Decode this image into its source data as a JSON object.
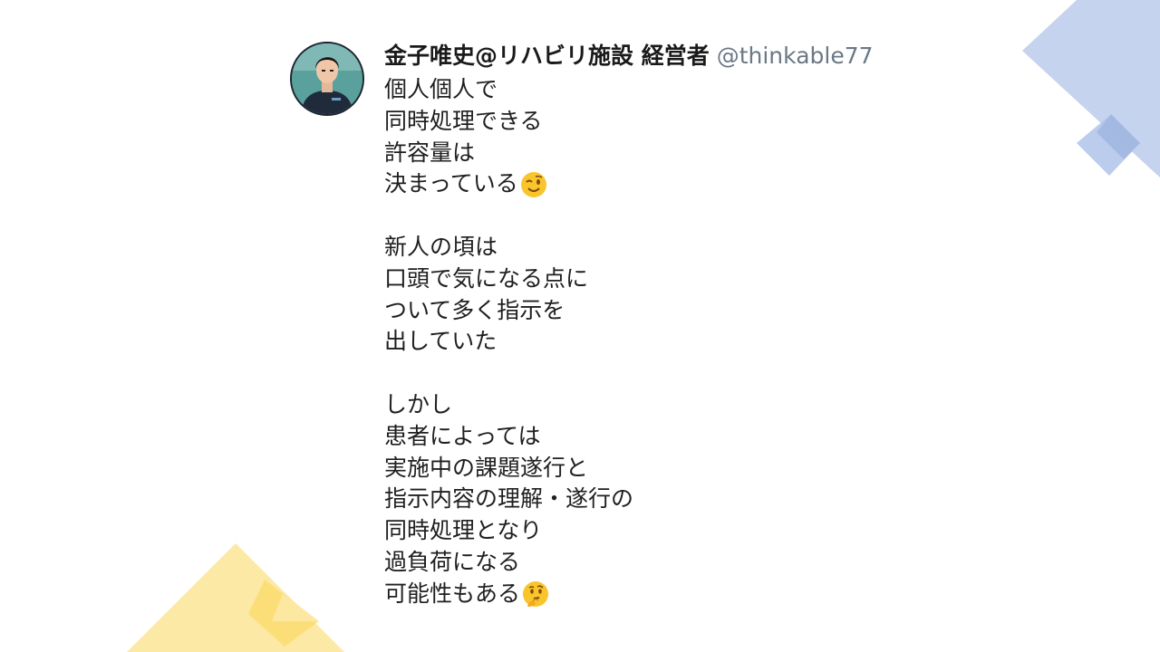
{
  "tweet": {
    "display_name": "金子唯史@リハビリ施設 経営者",
    "handle": "@thinkable77",
    "avatar_icon": "person-avatar-icon",
    "lines": [
      "個人個人で",
      "同時処理できる",
      "許容量は",
      "決まっている",
      "",
      "新人の頃は",
      "口頭で気になる点に",
      "ついて多く指示を",
      "出していた",
      "",
      "しかし",
      "患者によっては",
      "実施中の課題遂行と",
      "指示内容の理解・遂行の",
      "同時処理となり",
      "過負荷になる",
      "可能性もある"
    ],
    "emojis": {
      "line_3": "winking-face-emoji",
      "line_16": "thinking-face-emoji"
    }
  },
  "colors": {
    "deco_blue": "#c5d3ee",
    "deco_blue_dark": "#9fb5e0",
    "deco_yellow": "#fde9a6",
    "deco_yellow_dark": "#fbd96a",
    "text": "#1f1f1f",
    "handle": "#6b7885"
  }
}
